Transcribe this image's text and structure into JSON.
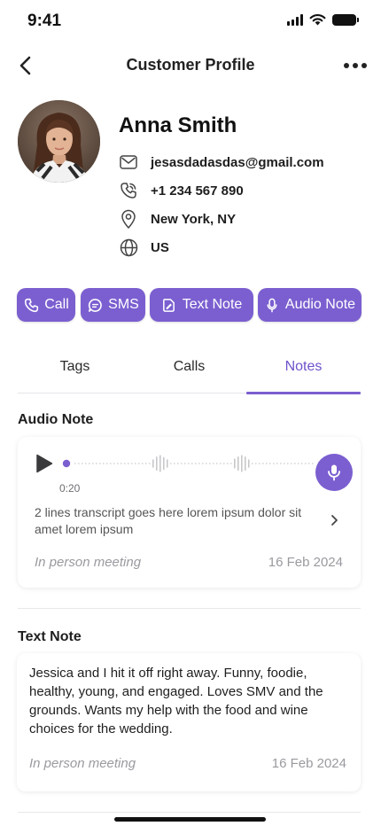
{
  "status_bar": {
    "time": "9:41"
  },
  "nav": {
    "title": "Customer Profile"
  },
  "profile": {
    "name": "Anna Smith",
    "email": "jesasdadasdas@gmail.com",
    "phone": "+1 234 567 890",
    "location": "New York, NY",
    "country": "US"
  },
  "actions": [
    {
      "label": "Call",
      "icon": "phone-icon"
    },
    {
      "label": "SMS",
      "icon": "chat-bubble-icon"
    },
    {
      "label": "Text Note",
      "icon": "note-icon"
    },
    {
      "label": "Audio Note",
      "icon": "mic-icon"
    }
  ],
  "tabs": [
    {
      "label": "Tags",
      "active": false
    },
    {
      "label": "Calls",
      "active": false
    },
    {
      "label": "Notes",
      "active": true
    }
  ],
  "audio_note": {
    "section_title": "Audio Note",
    "elapsed": "0:20",
    "transcript": "2 lines transcript goes here lorem ipsum dolor sit amet lorem ipsum",
    "context": "In person meeting",
    "date": "16 Feb 2024"
  },
  "text_note": {
    "section_title": "Text Note",
    "body": "Jessica and I hit it off right away. Funny, foodie, healthy, young, and engaged. Loves SMV and the grounds. Wants my help with the food and wine choices for the wedding.",
    "context": "In person meeting",
    "date": "16 Feb 2024"
  },
  "colors": {
    "accent": "#7b5fd0",
    "muted": "#9a9aa0"
  }
}
